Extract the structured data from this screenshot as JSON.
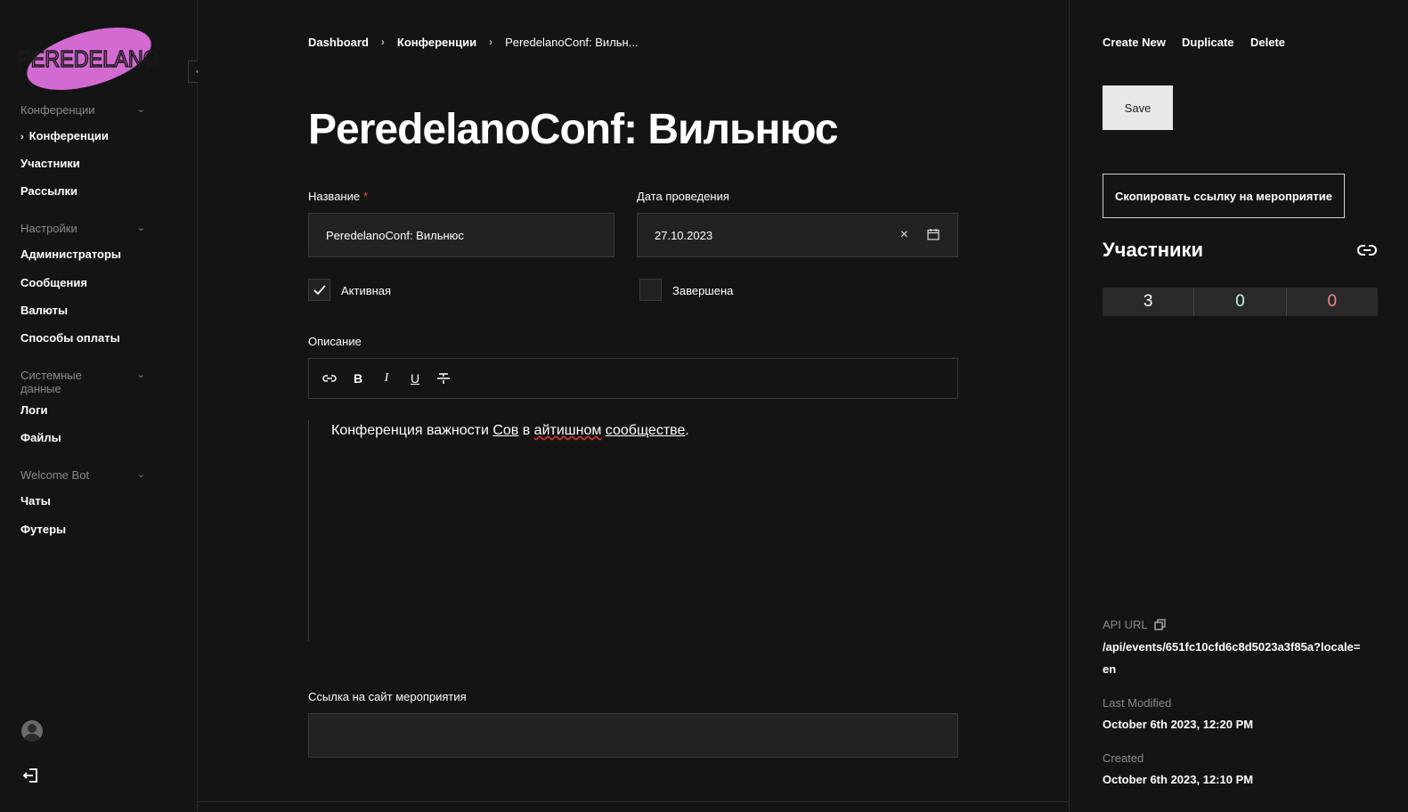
{
  "sidebar": {
    "logo_text": "PEREDELANO",
    "collapse_label": "«",
    "groups": [
      {
        "label": "Конференции"
      },
      {
        "label": "Настройки"
      },
      {
        "label": "Системные данные"
      },
      {
        "label": "Welcome Bot"
      }
    ],
    "items": [
      {
        "label": "Конференции"
      },
      {
        "label": "Участники"
      },
      {
        "label": "Рассылки"
      },
      {
        "label": "Администраторы"
      },
      {
        "label": "Сообщения"
      },
      {
        "label": "Валюты"
      },
      {
        "label": "Способы оплаты"
      },
      {
        "label": "Логи"
      },
      {
        "label": "Файлы"
      },
      {
        "label": "Чаты"
      },
      {
        "label": "Футеры"
      }
    ],
    "chevron": "⌄"
  },
  "breadcrumb": {
    "items": [
      "Dashboard",
      "Конференции",
      "PeredelanoConf: Вильн..."
    ],
    "separator": "›"
  },
  "page": {
    "title": "PeredelanoConf: Вильнюс"
  },
  "form": {
    "name_label": "Название",
    "required_mark": "*",
    "name_value": "PeredelanoConf: Вильнюс",
    "date_label": "Дата проведения",
    "date_value": "27.10.2023",
    "clear_symbol": "×",
    "active_label": "Активная",
    "active_checked": true,
    "finished_label": "Завершена",
    "finished_checked": false,
    "description_label": "Описание",
    "description_parts": {
      "p1": "Конференция важности ",
      "p2": "Сов",
      "p3": " в ",
      "p4": "айтишном",
      "p5": " ",
      "p6": "сообществе",
      "p7": "."
    },
    "toolbar": {
      "bold": "B",
      "italic": "I",
      "underline": "U"
    },
    "site_link_label": "Ссылка на сайт мероприятия",
    "site_link_value": ""
  },
  "actions": {
    "create_new": "Create New",
    "duplicate": "Duplicate",
    "delete": "Delete",
    "save": "Save",
    "copy_link": "Скопировать ссылку на мероприятие"
  },
  "participants": {
    "title": "Участники",
    "total": "3",
    "confirmed": "0",
    "rejected": "0"
  },
  "meta": {
    "api_url_label": "API URL",
    "api_url_value": "/api/events/651fc10cfd6c8d5023a3f85a?locale=en",
    "last_modified_label": "Last Modified",
    "last_modified_value": "October 6th 2023, 12:20 PM",
    "created_label": "Created",
    "created_value": "October 6th 2023, 12:10 PM"
  },
  "colors": {
    "background": "#141414",
    "input_bg": "#222222",
    "logo_accent": "#d26ad2",
    "stat_ok": "#bff5e3",
    "stat_bad": "#f08a8a"
  }
}
